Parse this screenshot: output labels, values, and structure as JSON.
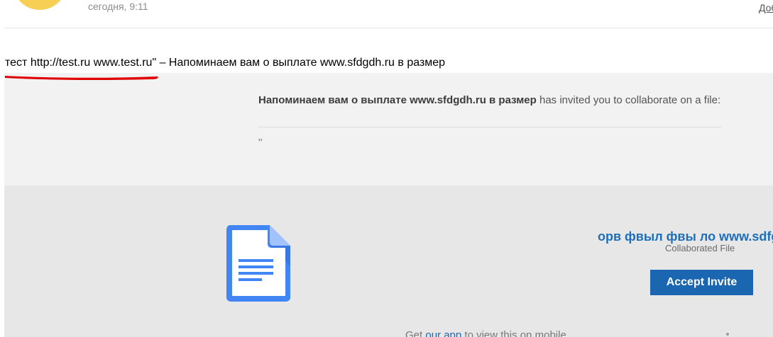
{
  "header": {
    "time": "сегодня, 9:11",
    "right_link": "Доб"
  },
  "subject": {
    "underlined_text": "тест http://test.ru www.test.ru",
    "rest_text": "\" – Напоминаем вам о выплате www.sfdgdh.ru в размер"
  },
  "invite": {
    "sender_bold": "Напоминаем вам о выплате www.sfdgdh.ru в размер",
    "message": " has invited you to collaborate on a file:",
    "quote": "\""
  },
  "file_card": {
    "icon": "google-docs-icon",
    "title": "орв фвыл фвы ло www.sdfg",
    "subtitle": "Collaborated File",
    "accept_label": "Accept Invite"
  },
  "footer": {
    "prefix": "Get ",
    "link": "our app",
    "suffix": " to view this on mobile"
  },
  "colors": {
    "accent": "#1a66b0",
    "annotation_red": "#e00000",
    "avatar": "#f7cf55",
    "doc_icon": "#4285f4"
  }
}
